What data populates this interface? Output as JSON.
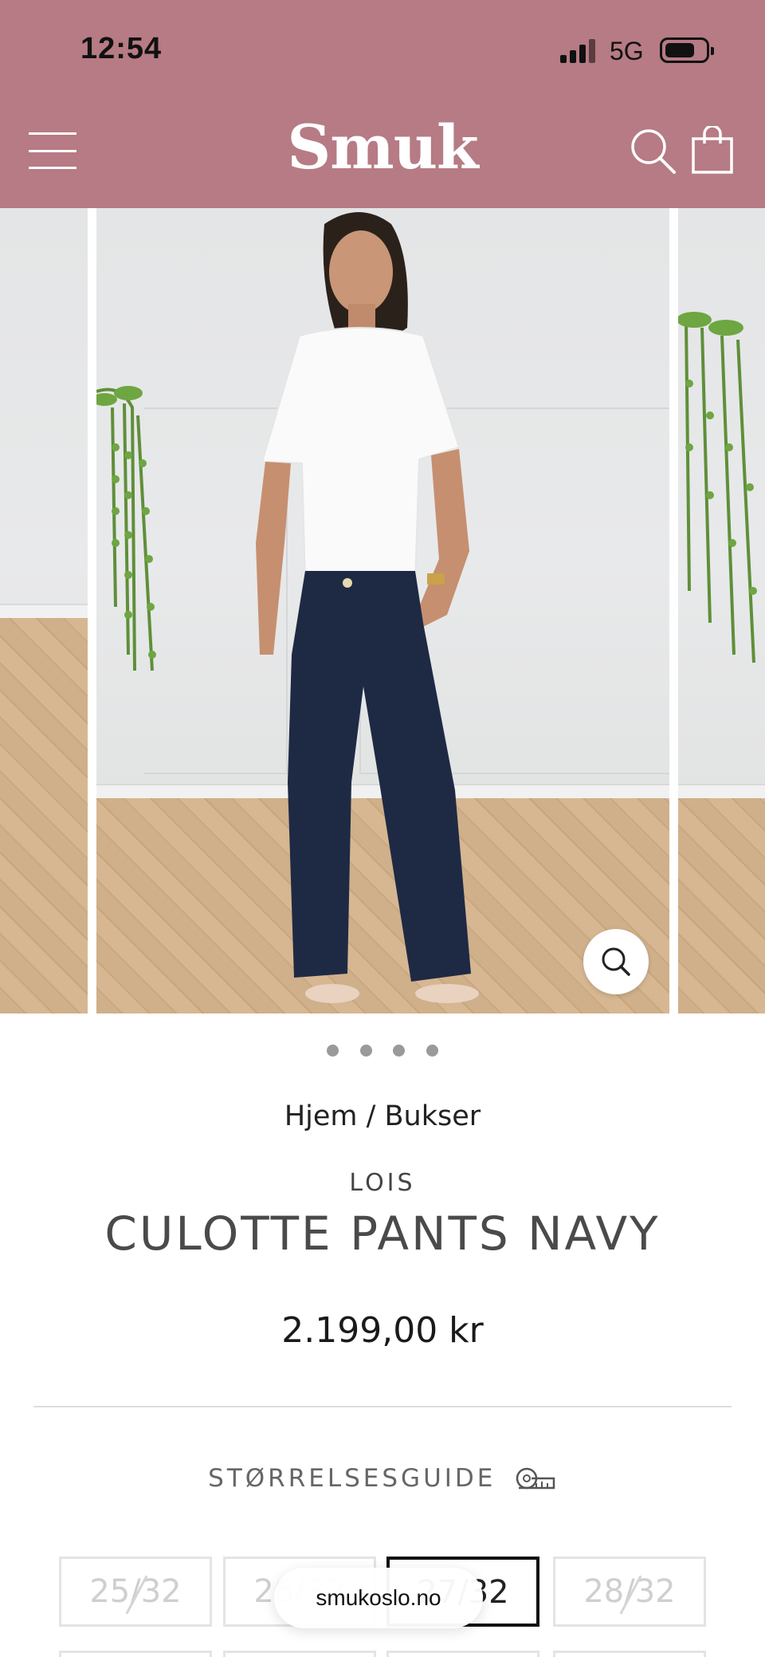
{
  "status_bar": {
    "time": "12:54",
    "network": "5G"
  },
  "header": {
    "logo": "Smuk",
    "background": "#b67b84"
  },
  "icons": {
    "menu": "hamburger-menu-icon",
    "search": "search-icon",
    "cart": "shopping-bag-icon",
    "zoom": "zoom-magnifier-icon",
    "size_guide": "measuring-tape-icon"
  },
  "gallery": {
    "image_count": 4,
    "active_index": 0
  },
  "breadcrumb": {
    "home": "Hjem",
    "separator": " / ",
    "category": "Bukser"
  },
  "product": {
    "brand": "LOIS",
    "title": "CULOTTE PANTS NAVY",
    "price": "2.199,00 kr"
  },
  "size_guide": {
    "label": "STØRRELSESGUIDE"
  },
  "sizes": [
    {
      "label": "25/32",
      "available": false,
      "selected": false
    },
    {
      "label": "26/32",
      "available": false,
      "selected": false
    },
    {
      "label": "27/32",
      "available": true,
      "selected": true
    },
    {
      "label": "28/32",
      "available": false,
      "selected": false
    }
  ],
  "browser": {
    "url": "smukoslo.no"
  }
}
